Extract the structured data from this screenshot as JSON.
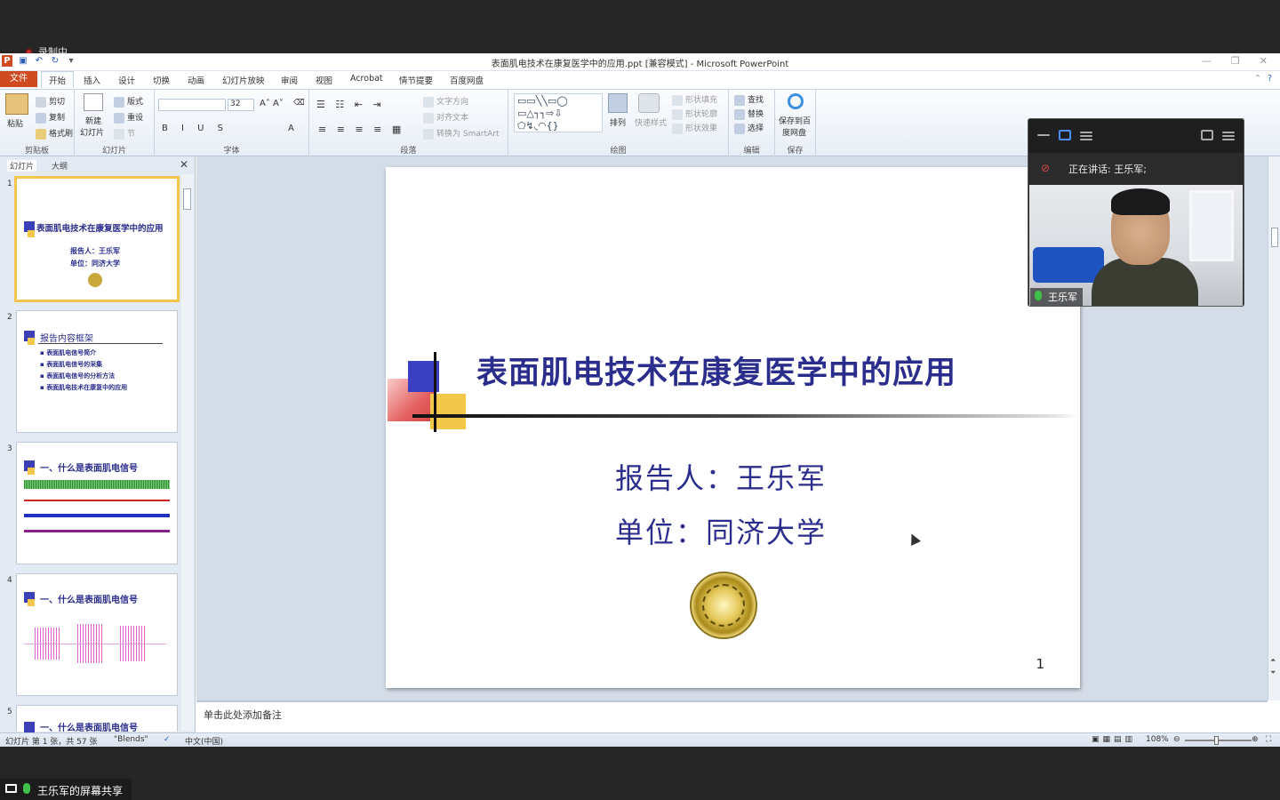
{
  "recording": {
    "label": "录制中"
  },
  "window": {
    "title": "表面肌电技术在康复医学中的应用.ppt [兼容模式] - Microsoft PowerPoint"
  },
  "tabs": {
    "file": "文件",
    "items": [
      "开始",
      "插入",
      "设计",
      "切换",
      "动画",
      "幻灯片放映",
      "审阅",
      "视图",
      "Acrobat",
      "情节提要",
      "百度网盘"
    ]
  },
  "ribbon": {
    "clipboard": {
      "paste": "粘贴",
      "cut": "剪切",
      "copy": "复制",
      "format_painter": "格式刷",
      "label": "剪贴板"
    },
    "slides": {
      "new_slide": "新建",
      "new_slide2": "幻灯片",
      "layout": "版式",
      "reset": "重设",
      "section": "节",
      "label": "幻灯片"
    },
    "font": {
      "font_size": "32",
      "label": "字体"
    },
    "paragraph": {
      "text_direction": "文字方向",
      "align_text": "对齐文本",
      "smartart": "转换为 SmartArt",
      "label": "段落"
    },
    "drawing": {
      "arrange": "排列",
      "quick_styles": "快速样式",
      "fill": "形状填充",
      "outline": "形状轮廓",
      "effects": "形状效果",
      "label": "绘图"
    },
    "editing": {
      "find": "查找",
      "replace": "替换",
      "select": "选择",
      "label": "编辑"
    },
    "save": {
      "save_to": "保存到百",
      "save_to2": "度网盘",
      "label": "保存"
    }
  },
  "sidebar": {
    "tab_slides": "幻灯片",
    "tab_outline": "大纲",
    "thumbs": [
      {
        "num": "1",
        "title": "表面肌电技术在康复医学中的应用",
        "l1": "报告人：王乐军",
        "l2": "单位：同济大学"
      },
      {
        "num": "2",
        "title": "报告内容框架",
        "bullets": [
          "表面肌电信号简介",
          "表面肌电信号的采集",
          "表面肌电信号的分析方法",
          "表面肌电技术在康复中的应用"
        ]
      },
      {
        "num": "3",
        "title": "一、什么是表面肌电信号"
      },
      {
        "num": "4",
        "title": "一、什么是表面肌电信号"
      },
      {
        "num": "5",
        "title": "一、什么是表面肌电信号"
      }
    ]
  },
  "slide": {
    "title": "表面肌电技术在康复医学中的应用",
    "reporter": "报告人：王乐军",
    "unit": "单位：同济大学",
    "page": "1"
  },
  "notes": {
    "placeholder": "单击此处添加备注"
  },
  "status": {
    "slide_info": "幻灯片 第 1 张，共 57 张",
    "theme": "\"Blends\"",
    "language": "中文(中国)",
    "zoom": "108%"
  },
  "video": {
    "speaking": "正在讲话: 王乐军;",
    "name": "王乐军"
  },
  "share": {
    "label": "王乐军的屏幕共享"
  }
}
